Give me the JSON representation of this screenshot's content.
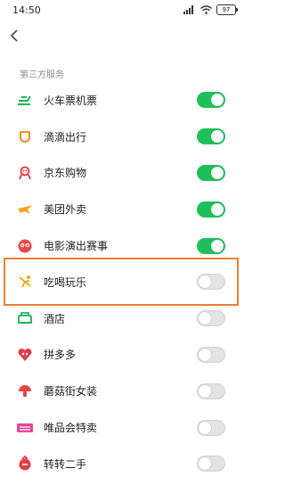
{
  "statusbar": {
    "time": "14:50",
    "battery": "97"
  },
  "section_title": "第三方服务",
  "items": [
    {
      "label": "火车票机票",
      "icon": "train-icon",
      "on": true
    },
    {
      "label": "滴滴出行",
      "icon": "didi-icon",
      "on": true
    },
    {
      "label": "京东购物",
      "icon": "jd-icon",
      "on": true
    },
    {
      "label": "美团外卖",
      "icon": "meituan-icon",
      "on": true
    },
    {
      "label": "电影演出赛事",
      "icon": "movie-icon",
      "on": true
    },
    {
      "label": "吃喝玩乐",
      "icon": "food-icon",
      "on": false
    },
    {
      "label": "酒店",
      "icon": "hotel-icon",
      "on": false
    },
    {
      "label": "拼多多",
      "icon": "pinduoduo-icon",
      "on": false
    },
    {
      "label": "蘑菇街女装",
      "icon": "mogujie-icon",
      "on": false
    },
    {
      "label": "唯品会特卖",
      "icon": "vip-sale-icon",
      "on": false
    },
    {
      "label": "转转二手",
      "icon": "zhuanzhuan-icon",
      "on": false
    }
  ],
  "colors": {
    "toggle_on": "#1fc05a",
    "highlight": "#f07d2e"
  }
}
